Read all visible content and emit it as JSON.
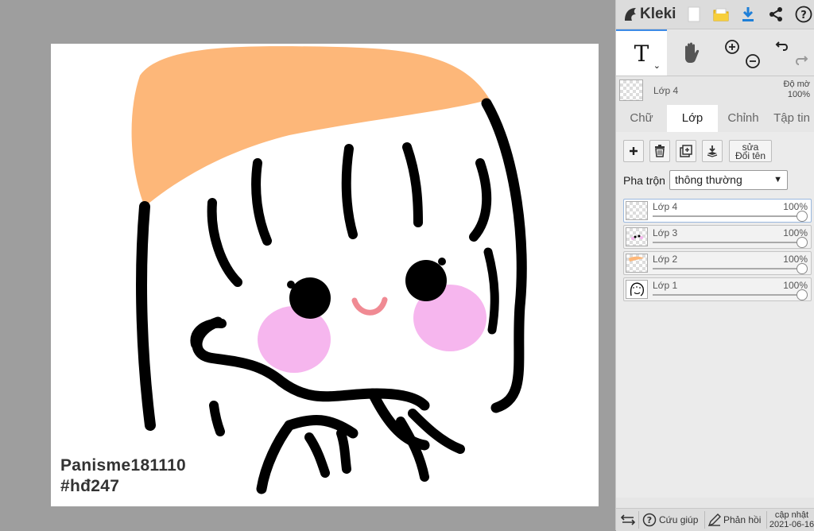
{
  "app": {
    "name": "Kleki"
  },
  "canvas": {
    "watermark_line1": "Panisme181110",
    "watermark_line2": "#hđ247"
  },
  "topbar": {
    "icons": [
      "new-file-icon",
      "open-folder-icon",
      "download-icon",
      "share-icon",
      "help-icon"
    ]
  },
  "tools": {
    "text_tool": "T",
    "hand_tool": "hand-icon",
    "zoom_in": "zoom-in-icon",
    "zoom_out": "zoom-out-icon",
    "undo": "undo-icon",
    "redo": "redo-icon"
  },
  "current_layer": {
    "name": "Lớp 4",
    "opacity_label": "Độ mờ",
    "opacity_value": "100%"
  },
  "tabs": [
    {
      "label": "Chữ",
      "active": false
    },
    {
      "label": "Lớp",
      "active": true
    },
    {
      "label": "Chỉnh",
      "active": false
    },
    {
      "label": "Tập tin",
      "active": false
    }
  ],
  "layer_panel": {
    "rename_line1": "sửa",
    "rename_line2": "Đổi tên",
    "blend_label": "Pha trộn",
    "blend_value": "thông thường",
    "layers": [
      {
        "name": "Lớp 4",
        "opacity": "100%",
        "selected": true
      },
      {
        "name": "Lớp 3",
        "opacity": "100%",
        "selected": false
      },
      {
        "name": "Lớp 2",
        "opacity": "100%",
        "selected": false
      },
      {
        "name": "Lớp 1",
        "opacity": "100%",
        "selected": false
      }
    ]
  },
  "footer": {
    "help": "Cứu giúp",
    "feedback": "Phản hồi",
    "update_line1": "cập nhật",
    "update_line2": "2021-06-16"
  },
  "colors": {
    "accent": "#3b8ae6",
    "hat": "#fdb779",
    "blush": "#f6b6ee",
    "mouth": "#f08a93",
    "ink": "#000000"
  }
}
